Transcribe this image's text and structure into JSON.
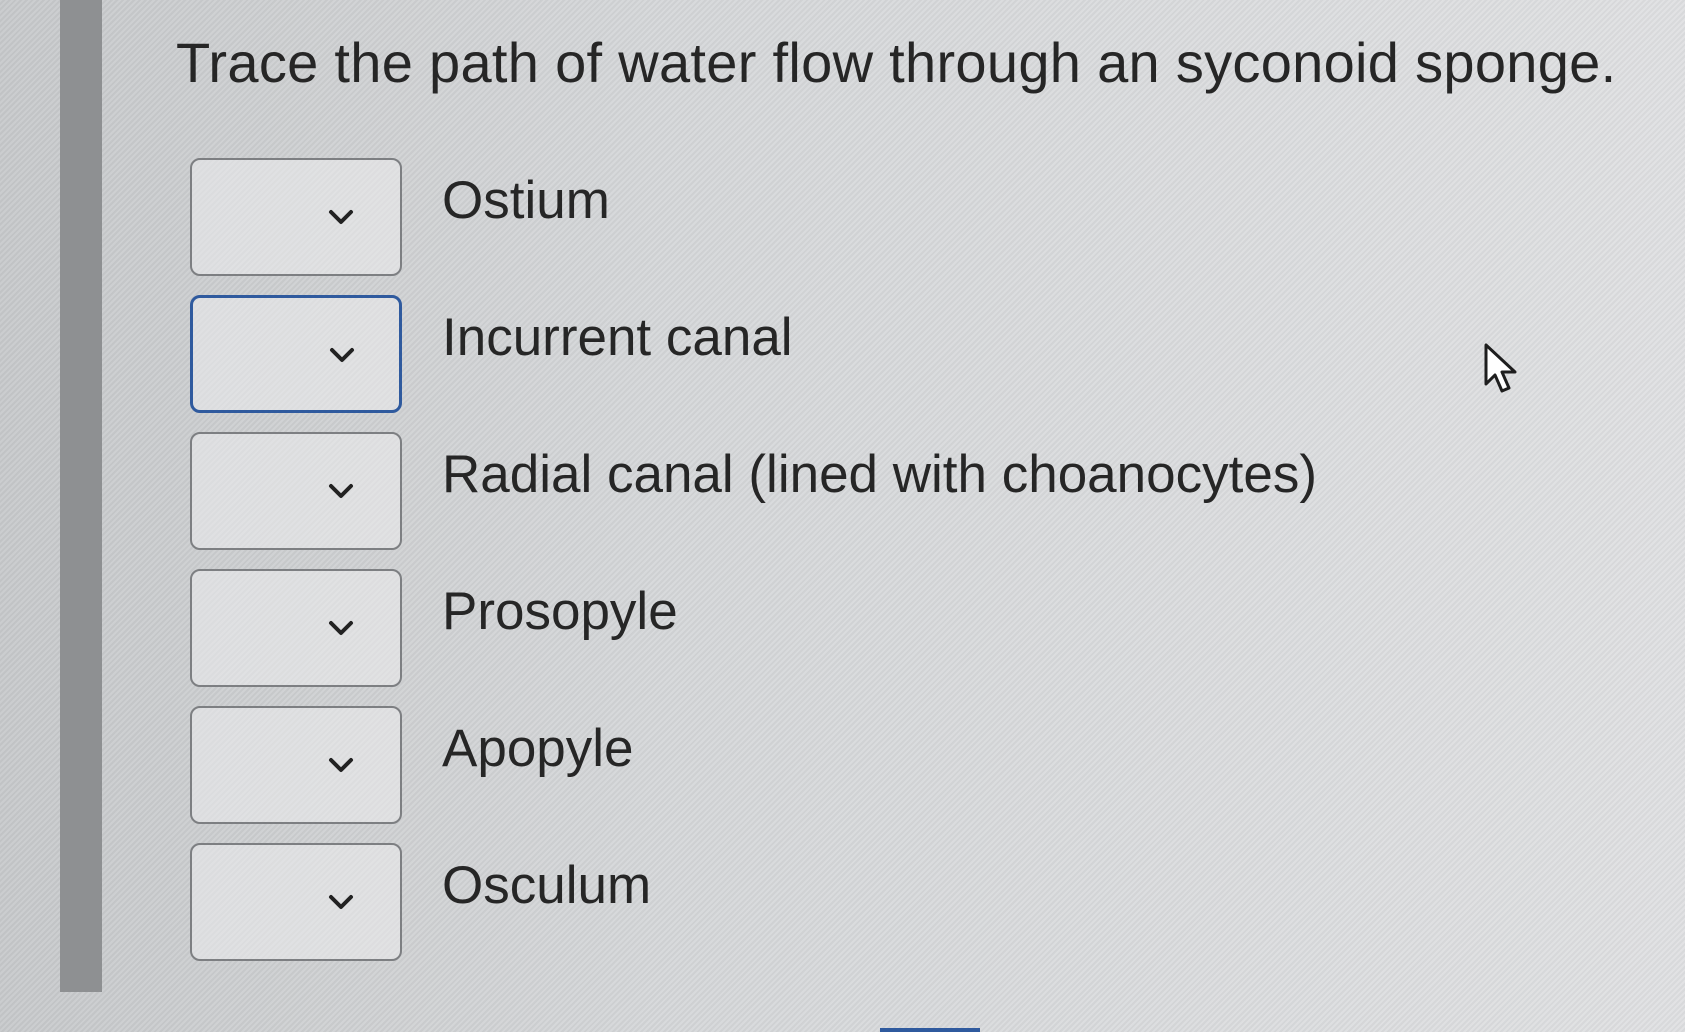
{
  "question": {
    "title": "Trace the path of water flow through an syconoid sponge."
  },
  "steps": [
    {
      "label": "Ostium",
      "selected_value": ""
    },
    {
      "label": "Incurrent canal",
      "selected_value": ""
    },
    {
      "label": "Radial canal (lined with choanocytes)",
      "selected_value": ""
    },
    {
      "label": "Prosopyle",
      "selected_value": ""
    },
    {
      "label": "Apopyle",
      "selected_value": ""
    },
    {
      "label": "Osculum",
      "selected_value": ""
    }
  ],
  "icons": {
    "dropdown": "chevron-down-icon",
    "pointer": "mouse-cursor-icon"
  },
  "colors": {
    "focus_border": "#2f5a9e",
    "box_border": "#7d7f82",
    "text": "#262626"
  }
}
